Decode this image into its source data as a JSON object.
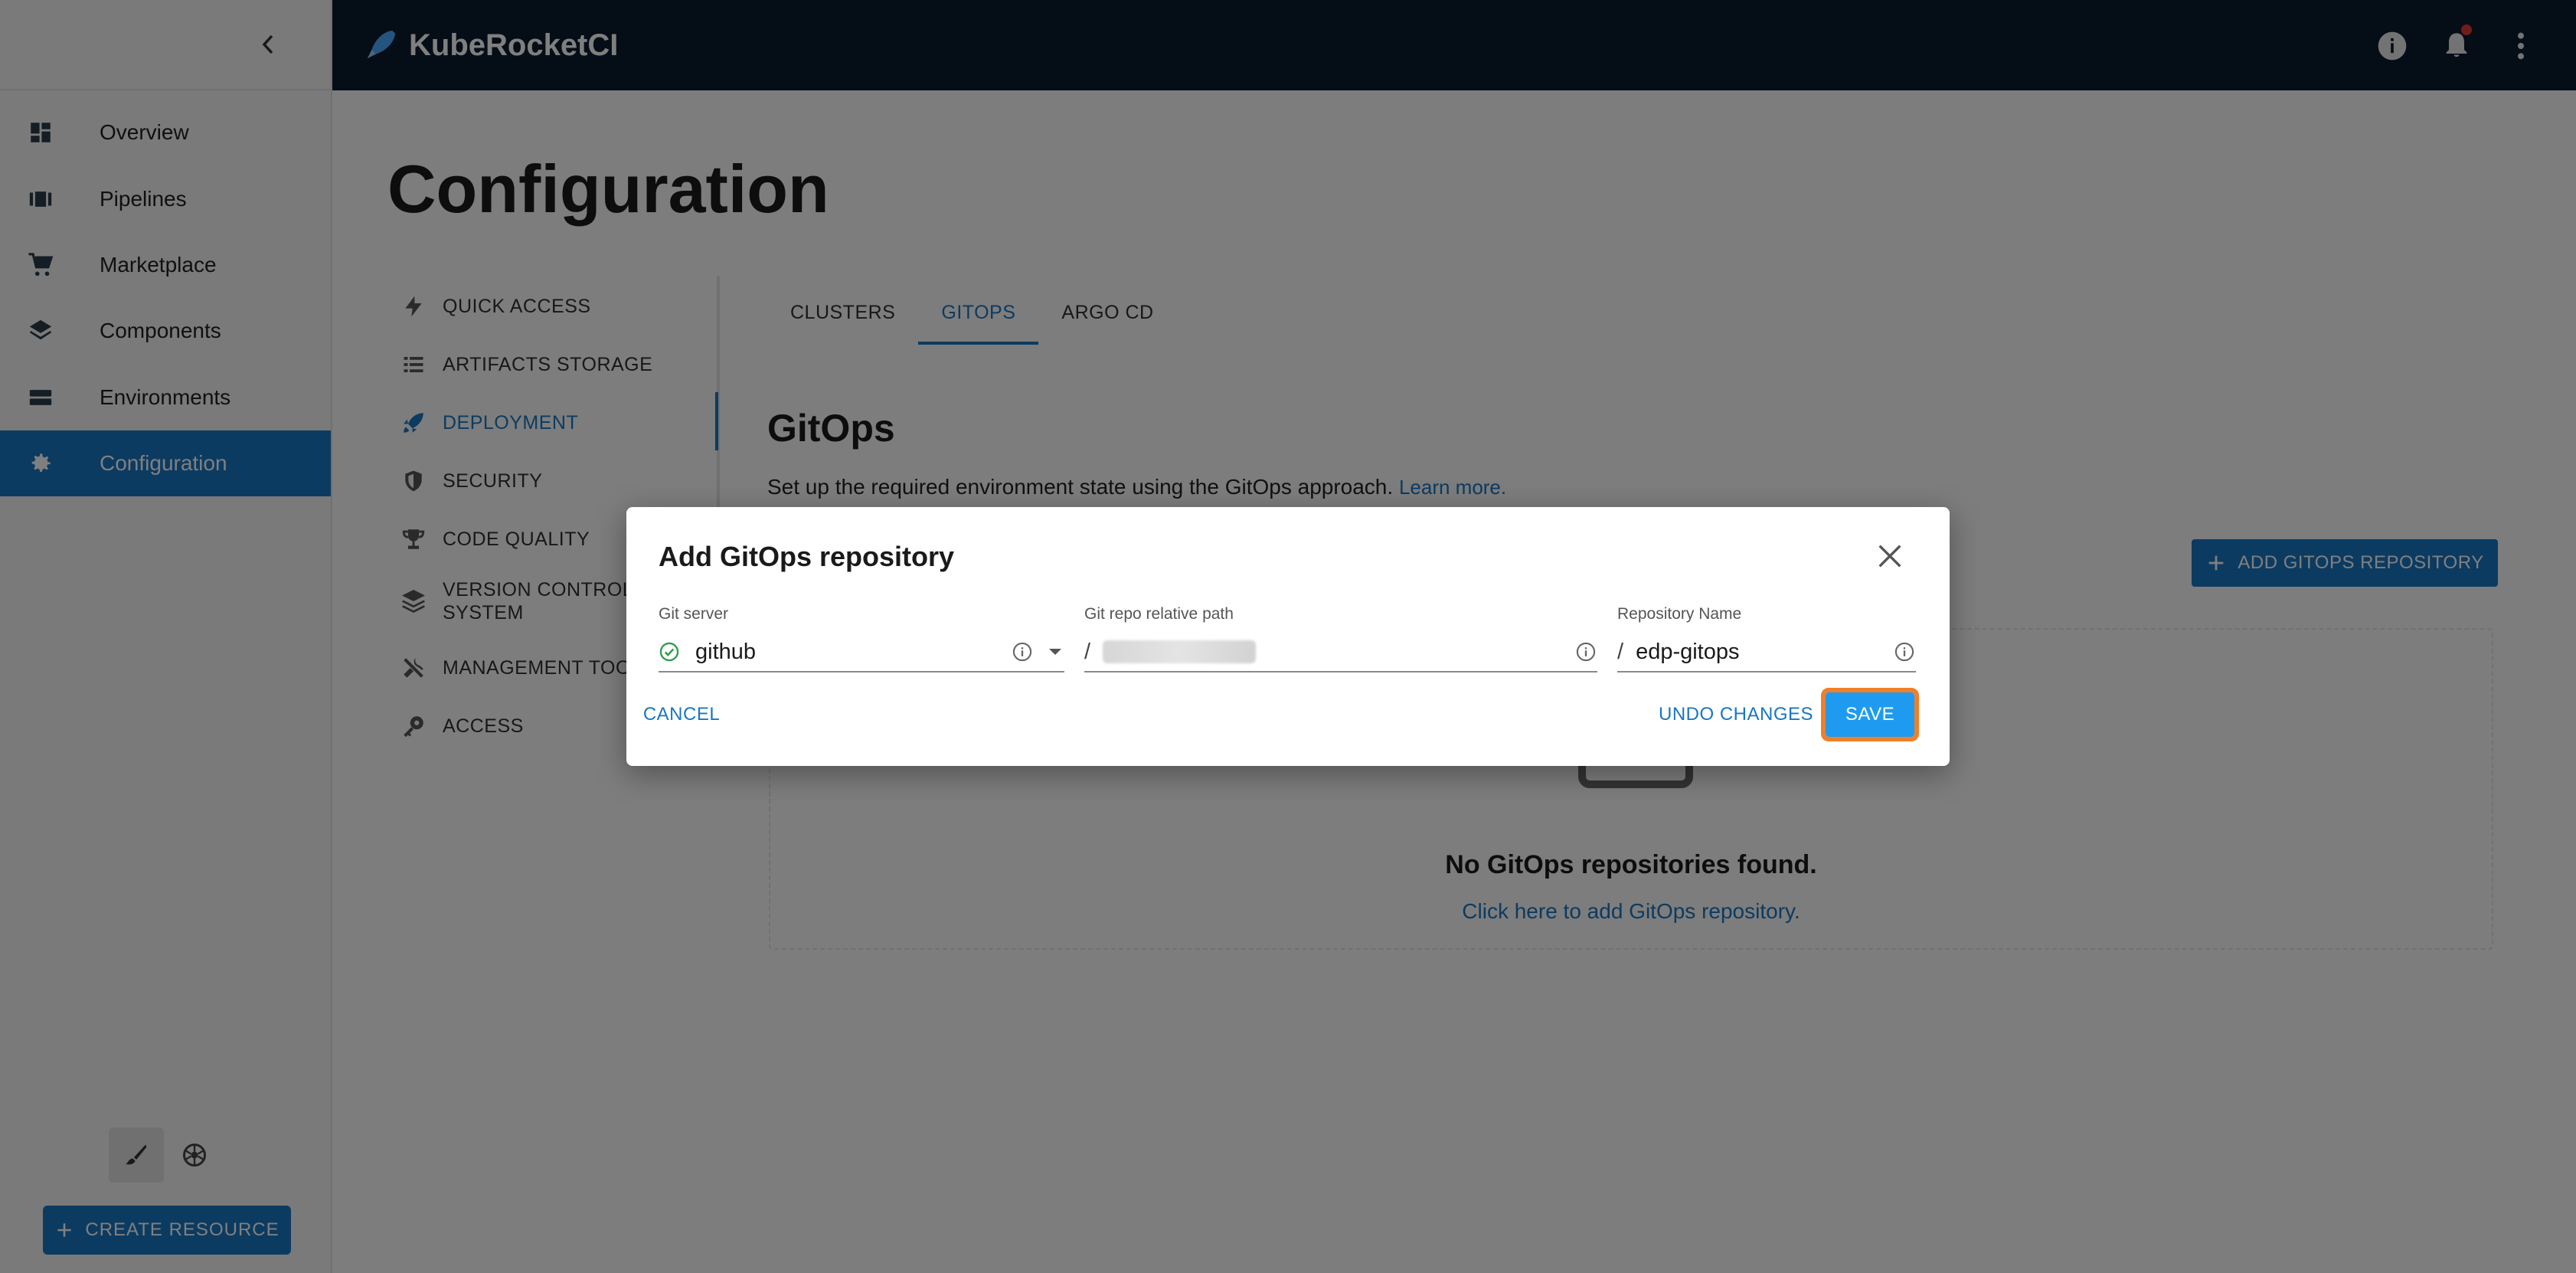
{
  "brand": {
    "name": "KubeRocketCI"
  },
  "sidebar": {
    "items": [
      {
        "label": "Overview",
        "icon": "dashboard-icon"
      },
      {
        "label": "Pipelines",
        "icon": "pipelines-icon"
      },
      {
        "label": "Marketplace",
        "icon": "cart-icon"
      },
      {
        "label": "Components",
        "icon": "layers-icon"
      },
      {
        "label": "Environments",
        "icon": "environments-icon"
      },
      {
        "label": "Configuration",
        "icon": "gear-icon",
        "active": true
      }
    ],
    "create_label": "CREATE RESOURCE"
  },
  "page": {
    "title": "Configuration"
  },
  "subnav": {
    "items": [
      {
        "label": "QUICK ACCESS"
      },
      {
        "label": "ARTIFACTS STORAGE"
      },
      {
        "label": "DEPLOYMENT",
        "active": true
      },
      {
        "label": "SECURITY"
      },
      {
        "label": "CODE QUALITY"
      },
      {
        "label": "VERSION CONTROL SYSTEM"
      },
      {
        "label": "MANAGEMENT TOOL"
      },
      {
        "label": "ACCESS"
      }
    ]
  },
  "tabs": [
    {
      "label": "CLUSTERS"
    },
    {
      "label": "GITOPS",
      "active": true
    },
    {
      "label": "ARGO CD"
    }
  ],
  "section": {
    "title": "GitOps",
    "description": "Set up the required environment state using the GitOps approach.",
    "learn_more": "Learn more.",
    "add_button": "ADD GITOPS REPOSITORY",
    "empty_title": "No GitOps repositories found.",
    "empty_link": "Click here to add GitOps repository."
  },
  "dialog": {
    "title": "Add GitOps repository",
    "git_server": {
      "label": "Git server",
      "value": "github"
    },
    "repo_path": {
      "label": "Git repo relative path",
      "prefix": "/"
    },
    "repo_name": {
      "label": "Repository Name",
      "prefix": "/",
      "value": "edp-gitops"
    },
    "cancel": "CANCEL",
    "undo": "UNDO CHANGES",
    "save": "SAVE"
  },
  "colors": {
    "accent": "#1976c2",
    "topbar": "#0b1a2f",
    "save": "#1e9bf0",
    "highlight": "#f07f2a"
  }
}
